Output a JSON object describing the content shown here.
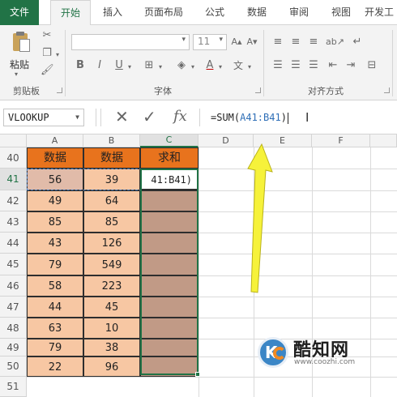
{
  "ribbon_tabs": [
    {
      "label": "文件",
      "active": false
    },
    {
      "label": "开始",
      "active": true
    },
    {
      "label": "插入",
      "active": false
    },
    {
      "label": "页面布局",
      "active": false
    },
    {
      "label": "公式",
      "active": false
    },
    {
      "label": "数据",
      "active": false
    },
    {
      "label": "审阅",
      "active": false
    },
    {
      "label": "视图",
      "active": false
    },
    {
      "label": "开发工",
      "active": false
    }
  ],
  "ribbon": {
    "paste_label": "粘贴",
    "groups": {
      "clipboard": "剪贴板",
      "font": "字体",
      "alignment": "对齐方式"
    },
    "font_size": "11",
    "bold": "B",
    "italic": "I",
    "underline": "U",
    "font_color_glyph": "A"
  },
  "formula_bar": {
    "name_box": "VLOOKUP",
    "formula_prefix": "=SUM(",
    "formula_ref": "A41:B41",
    "formula_suffix": ")",
    "fx": "fx"
  },
  "columns": [
    "A",
    "B",
    "C",
    "D",
    "E",
    "F"
  ],
  "rows": [
    "40",
    "41",
    "42",
    "43",
    "44",
    "45",
    "46",
    "47",
    "48",
    "49",
    "50",
    "51"
  ],
  "table": {
    "headers": [
      "数据",
      "数据",
      "求和"
    ],
    "rows": [
      {
        "a": "56",
        "b": "39"
      },
      {
        "a": "49",
        "b": "64"
      },
      {
        "a": "85",
        "b": "85"
      },
      {
        "a": "43",
        "b": "126"
      },
      {
        "a": "79",
        "b": "549"
      },
      {
        "a": "58",
        "b": "223"
      },
      {
        "a": "44",
        "b": "45"
      },
      {
        "a": "63",
        "b": "10"
      },
      {
        "a": "79",
        "b": "38"
      },
      {
        "a": "22",
        "b": "96"
      }
    ],
    "editing_text": "41:B41)"
  },
  "watermark": {
    "name": "酷知网",
    "url": "www.coozhi.com"
  },
  "colors": {
    "excel_green": "#217346",
    "header_orange": "#e8731d",
    "data_peach": "#f7c7a3",
    "sum_brown": "#c19a86",
    "arrow_yellow": "#f6f23a"
  }
}
